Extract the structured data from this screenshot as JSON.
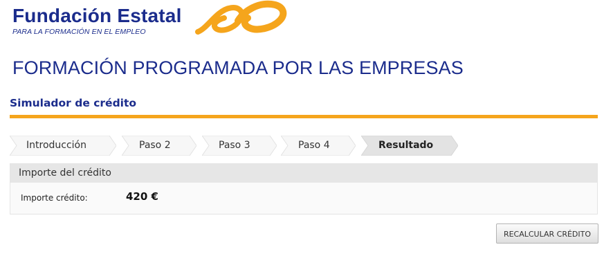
{
  "brand": {
    "name": "Fundación Estatal",
    "subtitle": "PARA LA FORMACIÓN EN EL EMPLEO",
    "logo_icon": "infinity-swoosh-logo",
    "brand_color": "#1b2c8c",
    "accent_color": "#f5a51c"
  },
  "page": {
    "title": "FORMACIÓN PROGRAMADA POR LAS EMPRESAS",
    "section_title": "Simulador de crédito"
  },
  "steps": [
    {
      "label": "Introducción",
      "active": false
    },
    {
      "label": "Paso 2",
      "active": false
    },
    {
      "label": "Paso 3",
      "active": false
    },
    {
      "label": "Paso 4",
      "active": false
    },
    {
      "label": "Resultado",
      "active": true
    }
  ],
  "result": {
    "header": "Importe del crédito",
    "label": "Importe crédito:",
    "value": "420 €"
  },
  "actions": {
    "recalculate": "RECALCULAR CRÉDITO"
  }
}
